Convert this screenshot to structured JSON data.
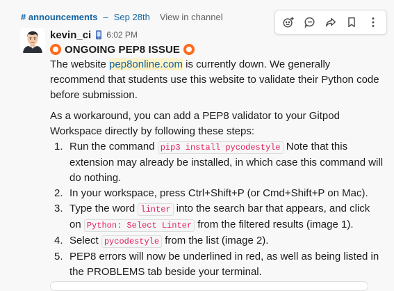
{
  "context": {
    "channel": "# announcements",
    "separator": "–",
    "date": "Sep 28th",
    "view_link": "View in channel"
  },
  "actions": [
    {
      "icon": "add-reaction-icon"
    },
    {
      "icon": "reply-in-thread-icon"
    },
    {
      "icon": "forward-icon"
    },
    {
      "icon": "bookmark-icon"
    },
    {
      "icon": "more-icon"
    }
  ],
  "message": {
    "username": "kevin_ci",
    "time": "6:02 PM",
    "title": "ONGOING PEP8 ISSUE",
    "p1_before": "The website ",
    "p1_link": "pep8online.com",
    "p1_after": " is currently down. We generally recommend that students use this website to validate their Python code before submission.",
    "p2": "As a workaround, you can add a PEP8 validator to your Gitpod Workspace directly by following these steps:",
    "steps": [
      {
        "n": "1.",
        "a": "Run the command ",
        "code": "pip3 install pycodestyle",
        "b": "  Note that this extension may already be installed, in which case this command will do nothing."
      },
      {
        "n": "2.",
        "a": "In your workspace, press Ctrl+Shift+P (or Cmd+Shift+P on Mac)."
      },
      {
        "n": "3.",
        "a": "Type the word ",
        "code": "linter",
        "b": " into the search bar that appears, and click on ",
        "code2": "Python: Select Linter",
        "c": " from the filtered results (image 1)."
      },
      {
        "n": "4.",
        "a": "Select ",
        "code": "pycodestyle",
        "b": " from the list (image 2)."
      },
      {
        "n": "5.",
        "a": "PEP8 errors will now be underlined in red, as well as being listed in the PROBLEMS tab beside your terminal."
      }
    ]
  },
  "colors": {
    "link": "#1264a3",
    "link_highlight": "#fdf1c5",
    "code": "#e01e5a",
    "ring": "#ff6b1a"
  }
}
